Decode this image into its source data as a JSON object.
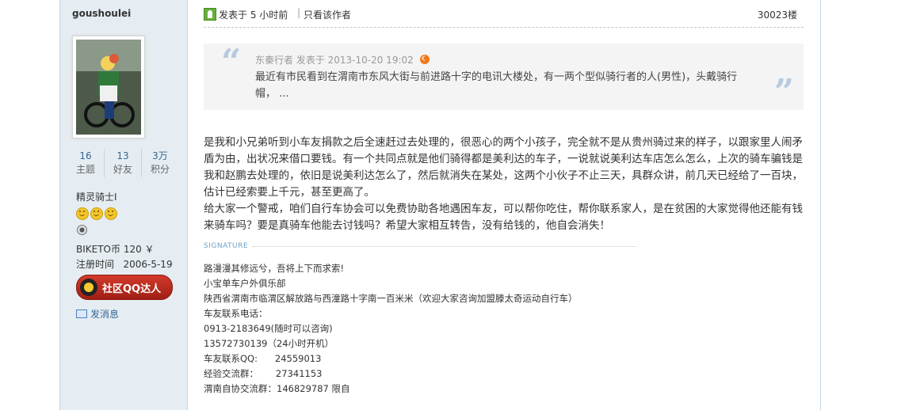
{
  "sidebar": {
    "username": "goushoulei",
    "stats": [
      {
        "value": "16",
        "label": "主题"
      },
      {
        "value": "13",
        "label": "好友"
      },
      {
        "value": "3万",
        "label": "积分"
      }
    ],
    "rank": "精灵骑士I",
    "currency": "BIKETO币  120 ￥",
    "register_label": "注册时间",
    "register_date": "2006-5-19",
    "qq_button": "社区QQ达人",
    "send_message": "发消息"
  },
  "post": {
    "posted_time": "发表于 5 小时前",
    "author_only": "只看该作者",
    "floor": "30023楼",
    "quote": {
      "meta": "东秦行者 发表于 2013-10-20 19:02",
      "text": "最近有市民看到在渭南市东风大街与前进路十字的电讯大楼处，有一两个型似骑行者的人(男性)，头戴骑行帽，  ..."
    },
    "paragraphs": [
      "是我和小兄弟听到小车友捐款之后全速赶过去处理的，很恶心的两个小孩子，完全就不是从贵州骑过来的样子，以跟家里人闹矛盾为由，出状况来借口要钱。有一个共同点就是他们骑得都是美利达的车子，一说就说美利达车店怎么怎么，上次的骑车骗钱是我和赵鹏去处理的，依旧是说美利达怎么了，然后就消失在某处，这两个小伙子不止三天，具群众讲，前几天已经给了一百块，估计已经索要上千元，甚至更高了。",
      "给大家一个警戒，咱们自行车协会可以免费协助各地遇困车友，可以帮你吃住，帮你联系家人，是在贫困的大家觉得他还能有钱来骑车吗？要是真骑车他能去讨钱吗？希望大家相互转告，没有给钱的，他自会消失！"
    ],
    "signature_label": "SIGNATURE",
    "signature_lines": [
      "路漫漫其修远兮，吾将上下而求索!",
      "",
      "小宝单车户外俱乐部",
      "陕西省渭南市临渭区解放路与西潼路十字南一百米米（欢迎大家咨询加盟滕太奇运动自行车）",
      "车友联系电话：",
      "0913-2183649(随时可以咨询)",
      "13572730139（24小时开机）",
      "车友联系QQ:      24559013",
      "经验交流群：      27341153",
      "渭南自协交流群：146829787 限自"
    ]
  },
  "colors": {
    "sidebar_bg": "#e5edf2",
    "link": "#336699",
    "quote_bg": "#f4f4f4",
    "qq_button": "#c0302a"
  },
  "icons": [
    "online-icon",
    "quote-left-icon",
    "quote-right-icon",
    "jump-arrow-icon",
    "smile-icon",
    "medal-icon",
    "qq-penguin-icon",
    "envelope-icon"
  ]
}
